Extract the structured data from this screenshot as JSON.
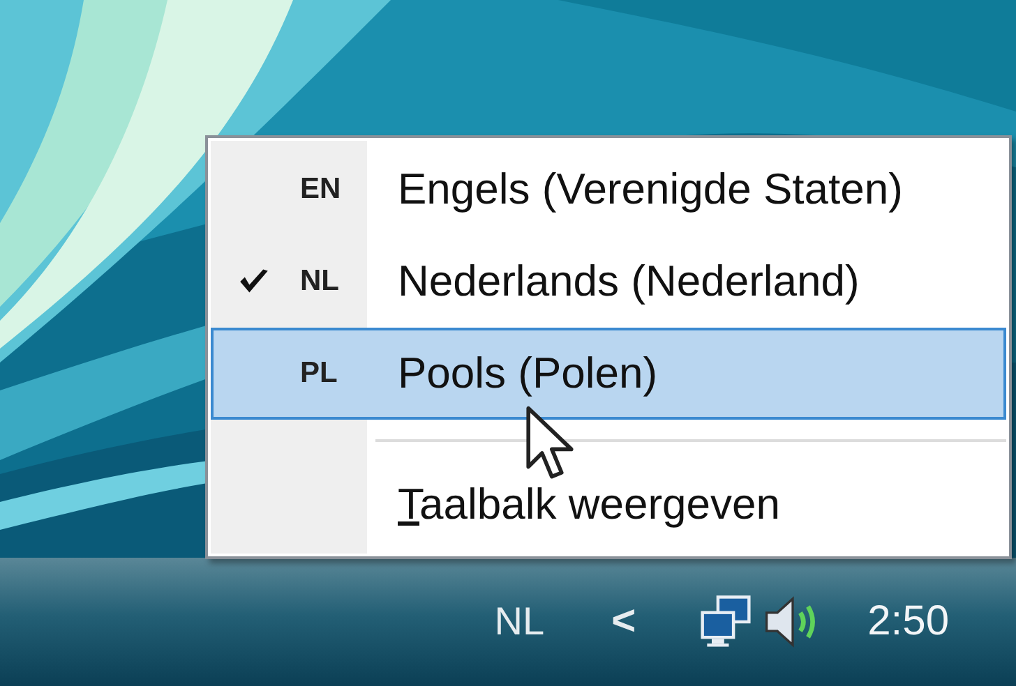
{
  "language_menu": {
    "items": [
      {
        "kind": "language",
        "code": "EN",
        "label": "Engels (Verenigde Staten)",
        "checked": false,
        "selected": false
      },
      {
        "kind": "language",
        "code": "NL",
        "label": "Nederlands (Nederland)",
        "checked": true,
        "selected": false
      },
      {
        "kind": "language",
        "code": "PL",
        "label": "Pools (Polen)",
        "checked": false,
        "selected": true
      },
      {
        "kind": "separator"
      },
      {
        "kind": "command",
        "label": "Taalbalk weergeven",
        "mnemonic_underlined": true,
        "selected": false
      }
    ]
  },
  "taskbar": {
    "language": "NL",
    "show_hidden": "<",
    "clock": "2:50"
  }
}
